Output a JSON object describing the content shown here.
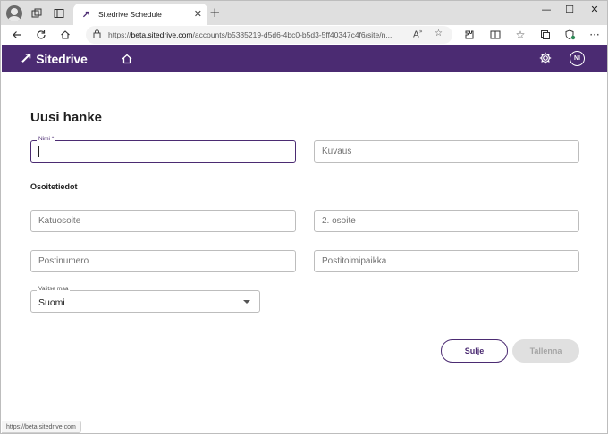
{
  "browser": {
    "tab_title": "Sitedrive Schedule",
    "url_prefix": "https://",
    "url_host": "beta.sitedrive.com",
    "url_path": "/accounts/b5385219-d5d6-4bc0-b5d3-5ff40347c4f6/site/n...",
    "status_url": "https://beta.sitedrive.com"
  },
  "app": {
    "brand_name": "Sitedrive",
    "brand_color": "#4b2b72",
    "user_initials": "NI"
  },
  "form": {
    "title": "Uusi hanke",
    "name_label": "Nimi *",
    "name_value": "",
    "description_placeholder": "Kuvaus",
    "address_section": "Osoitetiedot",
    "street_placeholder": "Katuosoite",
    "address2_placeholder": "2. osoite",
    "postal_code_placeholder": "Postinumero",
    "city_placeholder": "Postitoimipaikka",
    "country_label": "Valitse maa",
    "country_value": "Suomi",
    "close_label": "Sulje",
    "save_label": "Tallenna"
  }
}
